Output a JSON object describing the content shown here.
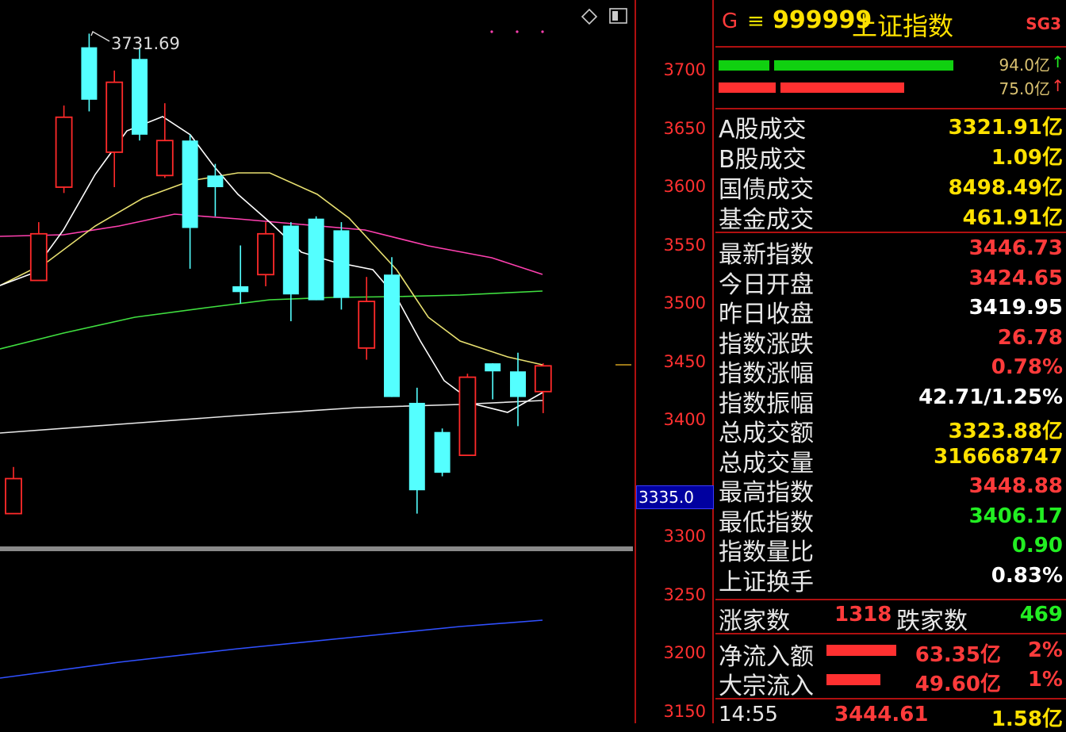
{
  "toolbar": {
    "diamond_icon": "diamond-icon",
    "window_icon": "window-icon"
  },
  "chart": {
    "price_axis": {
      "ticks": [
        "3700",
        "3650",
        "3600",
        "3550",
        "3500",
        "3450",
        "3400",
        "3300",
        "3250",
        "3200",
        "3150"
      ],
      "marker": "3335.0"
    },
    "high_label": "3731.69",
    "colors": {
      "up": "#ff2a2a",
      "down": "#54ffff",
      "ma5": "#ffffff",
      "ma10": "#e8e070",
      "ma20": "#ff40b0",
      "ma60": "#40e040",
      "ma120": "#e8e8e8",
      "vol": "#3050ff"
    }
  },
  "chart_data": {
    "type": "candlestick",
    "candles": [
      {
        "o": 3320,
        "c": 3350,
        "h": 3360,
        "l": 3320
      },
      {
        "o": 3520,
        "c": 3560,
        "h": 3570,
        "l": 3520
      },
      {
        "o": 3600,
        "c": 3660,
        "h": 3670,
        "l": 3595
      },
      {
        "o": 3720,
        "c": 3675,
        "h": 3731.69,
        "l": 3665
      },
      {
        "o": 3630,
        "c": 3690,
        "h": 3700,
        "l": 3600
      },
      {
        "o": 3710,
        "c": 3645,
        "h": 3720,
        "l": 3640
      },
      {
        "o": 3610,
        "c": 3640,
        "h": 3672,
        "l": 3608
      },
      {
        "o": 3640,
        "c": 3565,
        "h": 3645,
        "l": 3530
      },
      {
        "o": 3610,
        "c": 3600,
        "h": 3620,
        "l": 3575
      },
      {
        "o": 3515,
        "c": 3510,
        "h": 3550,
        "l": 3500
      },
      {
        "o": 3525,
        "c": 3560,
        "h": 3570,
        "l": 3515
      },
      {
        "o": 3567,
        "c": 3508,
        "h": 3570,
        "l": 3485
      },
      {
        "o": 3573,
        "c": 3503,
        "h": 3575,
        "l": 3503
      },
      {
        "o": 3563,
        "c": 3505,
        "h": 3570,
        "l": 3495
      },
      {
        "o": 3462,
        "c": 3502,
        "h": 3523,
        "l": 3452
      },
      {
        "o": 3525,
        "c": 3420,
        "h": 3540,
        "l": 3420
      },
      {
        "o": 3415,
        "c": 3340,
        "h": 3428,
        "l": 3320
      },
      {
        "o": 3390,
        "c": 3355,
        "h": 3393,
        "l": 3352
      },
      {
        "o": 3370,
        "c": 3437,
        "h": 3440,
        "l": 3370
      },
      {
        "o": 3448.9,
        "c": 3442,
        "h": 3449,
        "l": 3418
      },
      {
        "o": 3442,
        "c": 3420,
        "h": 3458,
        "l": 3395
      },
      {
        "o": 3424.65,
        "c": 3446.73,
        "h": 3448.88,
        "l": 3406.17
      }
    ]
  },
  "panel": {
    "header": {
      "g": "G",
      "menu": "≡",
      "code": "999999",
      "name": "上证指数",
      "tag": "SG3"
    },
    "flow": {
      "buy_val": "94.0亿",
      "buy_arrow": "↑",
      "sell_val": "75.0亿",
      "sell_arrow": "↑"
    },
    "turnover": [
      {
        "label": "A股成交",
        "value": "3321.91亿"
      },
      {
        "label": "B股成交",
        "value": "1.09亿"
      },
      {
        "label": "国债成交",
        "value": "8498.49亿"
      },
      {
        "label": "基金成交",
        "value": "461.91亿"
      }
    ],
    "stats": [
      {
        "label": "最新指数",
        "value": "3446.73",
        "cls": "r"
      },
      {
        "label": "今日开盘",
        "value": "3424.65",
        "cls": "r"
      },
      {
        "label": "昨日收盘",
        "value": "3419.95",
        "cls": "w"
      },
      {
        "label": "指数涨跌",
        "value": "26.78",
        "cls": "r"
      },
      {
        "label": "指数涨幅",
        "value": "0.78%",
        "cls": "r"
      },
      {
        "label": "指数振幅",
        "value": "42.71/1.25%",
        "cls": "w"
      },
      {
        "label": "总成交额",
        "value": "3323.88亿",
        "cls": "y"
      },
      {
        "label": "总成交量",
        "value": "316668747",
        "cls": "y"
      },
      {
        "label": "最高指数",
        "value": "3448.88",
        "cls": "r"
      },
      {
        "label": "最低指数",
        "value": "3406.17",
        "cls": "gr"
      },
      {
        "label": "指数量比",
        "value": "0.90",
        "cls": "gr"
      },
      {
        "label": "上证换手",
        "value": "0.83%",
        "cls": "w"
      }
    ],
    "breadth": {
      "up_label": "涨家数",
      "up_value": "1318",
      "down_label": "跌家数",
      "down_value": "469"
    },
    "inflow": [
      {
        "label": "净流入额",
        "amount": "63.35亿",
        "pct": "2%"
      },
      {
        "label": "大宗流入",
        "amount": "49.60亿",
        "pct": "1%"
      }
    ],
    "last_tick": {
      "time": "14:55",
      "price": "3444.61",
      "amount": "1.58亿"
    }
  }
}
